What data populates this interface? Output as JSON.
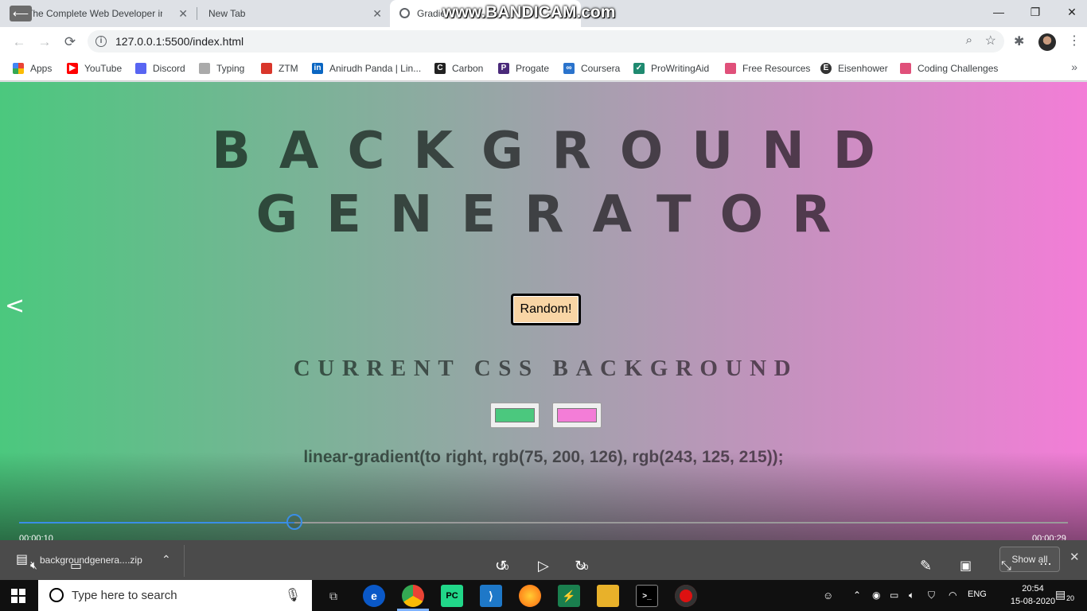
{
  "tabs": [
    {
      "label": "The Complete Web Developer in",
      "close": "✕"
    },
    {
      "label": "New Tab",
      "close": "✕"
    },
    {
      "label": "Gradie",
      "close": "✕"
    }
  ],
  "watermark": "www.BANDICAM.com",
  "window_controls": {
    "minimize": "—",
    "maximize": "❐",
    "close": "✕"
  },
  "address": {
    "url": "127.0.0.1:5500/index.html"
  },
  "bookmarks": [
    {
      "label": "Apps",
      "color": "#ea4335"
    },
    {
      "label": "YouTube",
      "color": "#ff0000"
    },
    {
      "label": "Discord",
      "color": "#5865f2"
    },
    {
      "label": "Typing",
      "color": "#888888"
    },
    {
      "label": "ZTM",
      "color": "#d9362b"
    },
    {
      "label": "Anirudh Panda | Lin...",
      "color": "#0a66c2"
    },
    {
      "label": "Carbon",
      "color": "#222222"
    },
    {
      "label": "Progate",
      "color": "#4a2a7a"
    },
    {
      "label": "Coursera",
      "color": "#2a73cc"
    },
    {
      "label": "ProWritingAid",
      "color": "#1f8a70"
    },
    {
      "label": "Free Resources",
      "color": "#e0507a"
    },
    {
      "label": "Eisenhower",
      "color": "#333333"
    },
    {
      "label": "Coding Challenges",
      "color": "#e0507a"
    }
  ],
  "page": {
    "title_line1": "BACKGROUND",
    "title_line2": "GENERATOR",
    "random_button": "Random!",
    "subtitle": "CURRENT CSS BACKGROUND",
    "color1": "#4bc87e",
    "color2": "#f37dd7",
    "css_text": "linear-gradient(to right, rgb(75, 200, 126), rgb(243, 125, 215));"
  },
  "player": {
    "elapsed": "00:00:10",
    "duration": "00:00:29",
    "progress_fraction": 0.2625,
    "rewind_label": "10",
    "forward_label": "30"
  },
  "download": {
    "filename": "backgroundgenera....zip",
    "show_all": "Show all"
  },
  "taskbar": {
    "search_placeholder": "Type here to search",
    "lang": "ENG",
    "time": "20:54",
    "date": "15-08-2020",
    "notifications": "20"
  }
}
